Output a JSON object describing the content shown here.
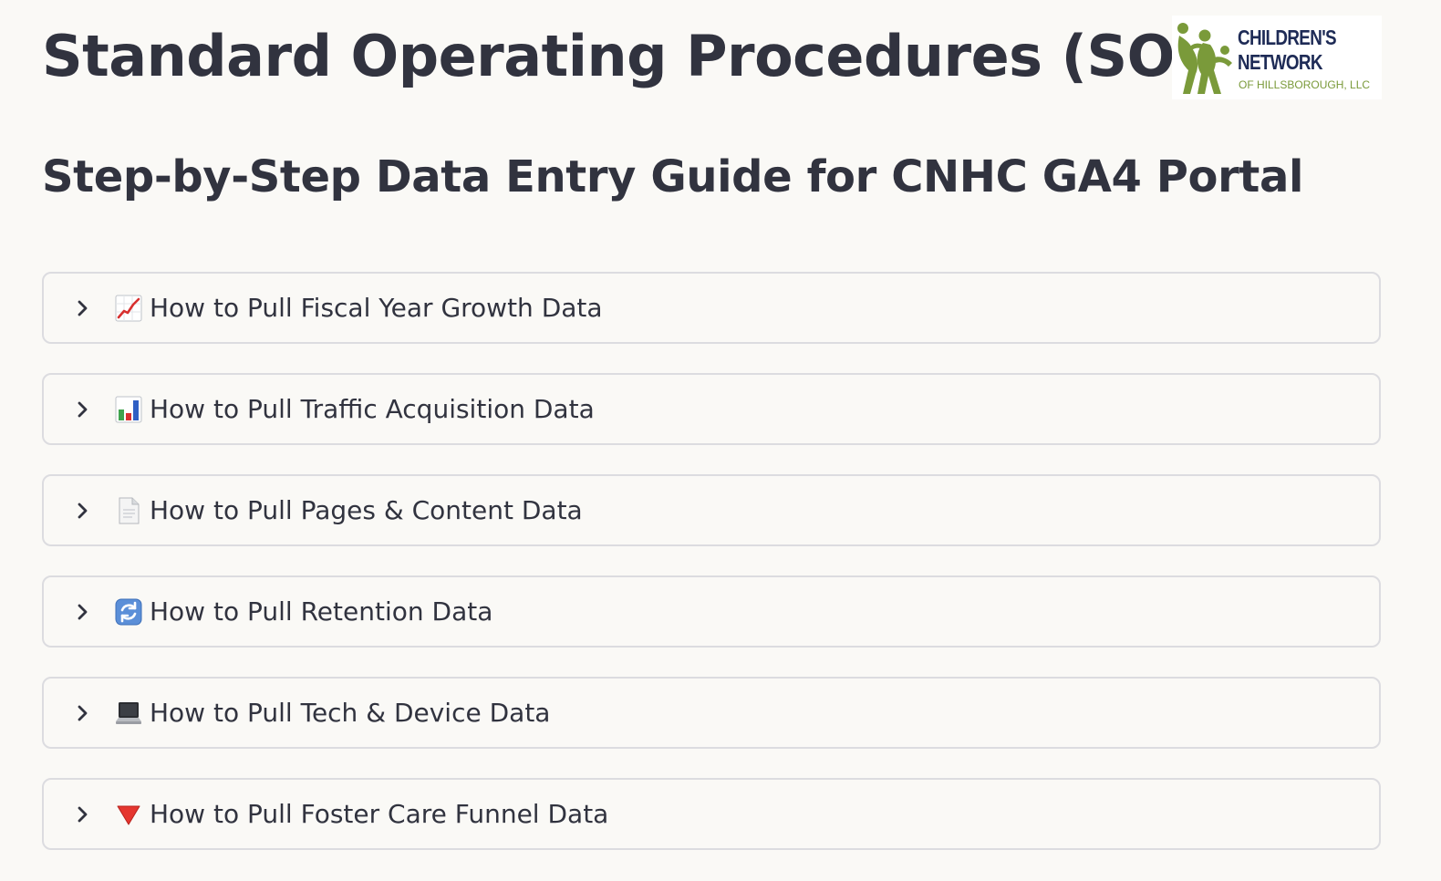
{
  "header": {
    "title": "Standard Operating Procedures (SOP)",
    "subtitle": "Step-by-Step Data Entry Guide for CNHC GA4 Portal"
  },
  "logo": {
    "line1": "CHILDREN'S",
    "line2": "NETWORK",
    "line3": "OF HILLSBOROUGH, LLC",
    "colors": {
      "navy": "#1E2B56",
      "green": "#7A9A3A"
    }
  },
  "expanders": [
    {
      "icon": "chart-increasing-icon",
      "label": "How to Pull Fiscal Year Growth Data",
      "expanded": false
    },
    {
      "icon": "bar-chart-icon",
      "label": "How to Pull Traffic Acquisition Data",
      "expanded": false
    },
    {
      "icon": "page-icon",
      "label": "How to Pull Pages & Content Data",
      "expanded": false
    },
    {
      "icon": "counterclockwise-arrows-icon",
      "label": "How to Pull Retention Data",
      "expanded": false
    },
    {
      "icon": "laptop-icon",
      "label": "How to Pull Tech & Device Data",
      "expanded": false
    },
    {
      "icon": "red-triangle-down-icon",
      "label": "How to Pull Foster Care Funnel Data",
      "expanded": false
    }
  ],
  "theme": {
    "background": "#FAF9F6",
    "text": "#31333F",
    "border": "#DCDCE0"
  }
}
